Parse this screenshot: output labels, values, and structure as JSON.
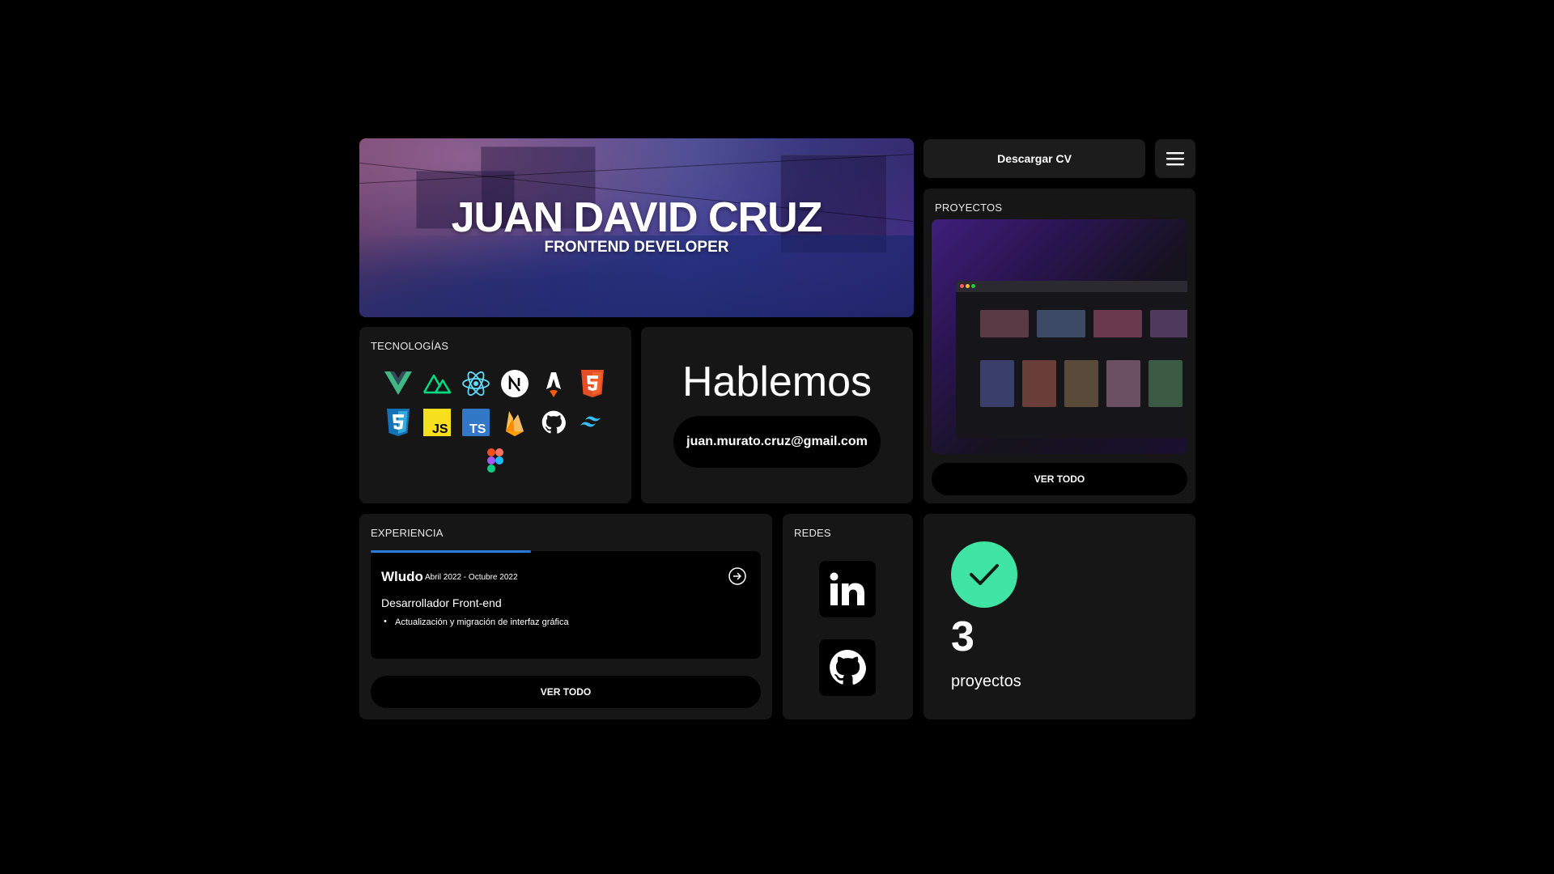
{
  "hero": {
    "name": "JUAN DAVID CRUZ",
    "role": "FRONTEND DEVELOPER"
  },
  "header": {
    "cv_label": "Descargar CV",
    "menu_icon": "hamburger-menu-icon"
  },
  "technologies": {
    "label": "TECNOLOGÍAS",
    "icons": [
      "vue",
      "nuxt",
      "react",
      "nextjs",
      "astro",
      "html5",
      "css3",
      "javascript",
      "typescript",
      "firebase",
      "github",
      "tailwind",
      "figma"
    ]
  },
  "contact": {
    "title": "Hablemos",
    "email": "juan.murato.cruz@gmail.com"
  },
  "projects": {
    "label": "PROYECTOS",
    "button_label": "VER TODO"
  },
  "experience": {
    "label": "EXPERIENCIA",
    "progress_fraction": 0.41,
    "entry": {
      "company": "Wludo",
      "dates": "Abril 2022 - Octubre 2022",
      "role": "Desarrollador Front-end",
      "bullet": "Actualización y migración de interfaz gráfica"
    },
    "button_label": "VER TODO"
  },
  "social": {
    "label": "REDES",
    "links": [
      "linkedin-icon",
      "github-icon"
    ]
  },
  "stats": {
    "count": "3",
    "label": "proyectos",
    "accent": "#3fe3a4"
  }
}
